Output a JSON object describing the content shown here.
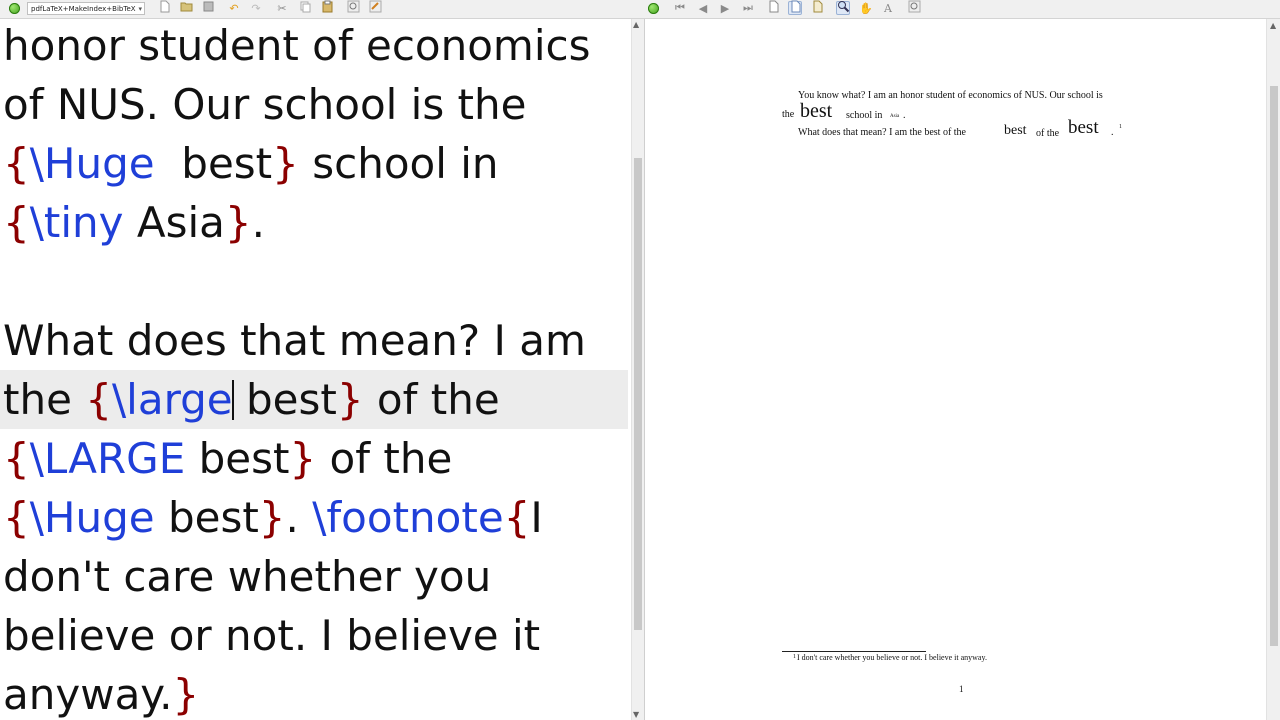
{
  "toolbar": {
    "compiler_label": "pdfLaTeX+MakeIndex+BibTeX",
    "icons": [
      "build-run",
      "new-file",
      "open-file",
      "save",
      "undo",
      "redo",
      "cut",
      "copy",
      "paste",
      "find",
      "replace",
      "typeset",
      "first-page",
      "previous-page",
      "next-page",
      "last-page",
      "single-page",
      "continuous",
      "facing-pages",
      "magnifier",
      "hand-tool",
      "select-text",
      "find-viewer"
    ]
  },
  "editor": {
    "lines": [
      [
        {
          "t": "honor student of economics",
          "c": "text"
        }
      ],
      [
        {
          "t": "of NUS. Our school is the",
          "c": "text"
        }
      ],
      [
        {
          "t": "{",
          "c": "brace"
        },
        {
          "t": "\\Huge",
          "c": "command"
        },
        {
          "t": "  best",
          "c": "text"
        },
        {
          "t": "}",
          "c": "brace"
        },
        {
          "t": " school in",
          "c": "text"
        }
      ],
      [
        {
          "t": "{",
          "c": "brace"
        },
        {
          "t": "\\tiny",
          "c": "command"
        },
        {
          "t": " Asia",
          "c": "text"
        },
        {
          "t": "}",
          "c": "brace"
        },
        {
          "t": ".",
          "c": "text"
        }
      ],
      [],
      [
        {
          "t": "What does that mean? I am",
          "c": "text"
        }
      ],
      [
        {
          "t": "the ",
          "c": "text"
        },
        {
          "t": "{",
          "c": "brace"
        },
        {
          "t": "\\large",
          "c": "command"
        },
        {
          "t": "|",
          "c": "cursor"
        },
        {
          "t": " best",
          "c": "text"
        },
        {
          "t": "}",
          "c": "brace"
        },
        {
          "t": " of the",
          "c": "text"
        }
      ],
      [
        {
          "t": "{",
          "c": "brace"
        },
        {
          "t": "\\LARGE",
          "c": "command"
        },
        {
          "t": " best",
          "c": "text"
        },
        {
          "t": "}",
          "c": "brace"
        },
        {
          "t": " of the",
          "c": "text"
        }
      ],
      [
        {
          "t": "{",
          "c": "brace"
        },
        {
          "t": "\\Huge",
          "c": "command"
        },
        {
          "t": " best",
          "c": "text"
        },
        {
          "t": "}",
          "c": "brace"
        },
        {
          "t": ". ",
          "c": "text"
        },
        {
          "t": "\\footnote",
          "c": "command"
        },
        {
          "t": "{",
          "c": "brace"
        },
        {
          "t": "I",
          "c": "text"
        }
      ],
      [
        {
          "t": "don't care whether you",
          "c": "text"
        }
      ],
      [
        {
          "t": "believe or not. I believe it",
          "c": "text"
        }
      ],
      [
        {
          "t": "anyway.",
          "c": "text"
        },
        {
          "t": "}",
          "c": "brace"
        }
      ]
    ],
    "current_line_index": 6
  },
  "viewer": {
    "p1_line1": "You know what? I am an honor student of economics of NUS. Our school is",
    "p1_the": "the",
    "p1_best_huge": "best",
    "p1_school_in": "school in",
    "p1_asia_tiny": "Asia",
    "p1_period": ".",
    "p2_text": "What does that mean? I am the best of the",
    "p2_best_large": "best",
    "p2_of_the": "of the",
    "p2_best_huge": "best",
    "p2_period": ".",
    "footnote_mark": "1",
    "footnote_text": "I don't care whether you believe or not. I believe it anyway.",
    "page_number": "1"
  },
  "colors": {
    "brace": "#8b0000",
    "command": "#1f3fd8",
    "text": "#111111",
    "current_line": "#ececec"
  }
}
